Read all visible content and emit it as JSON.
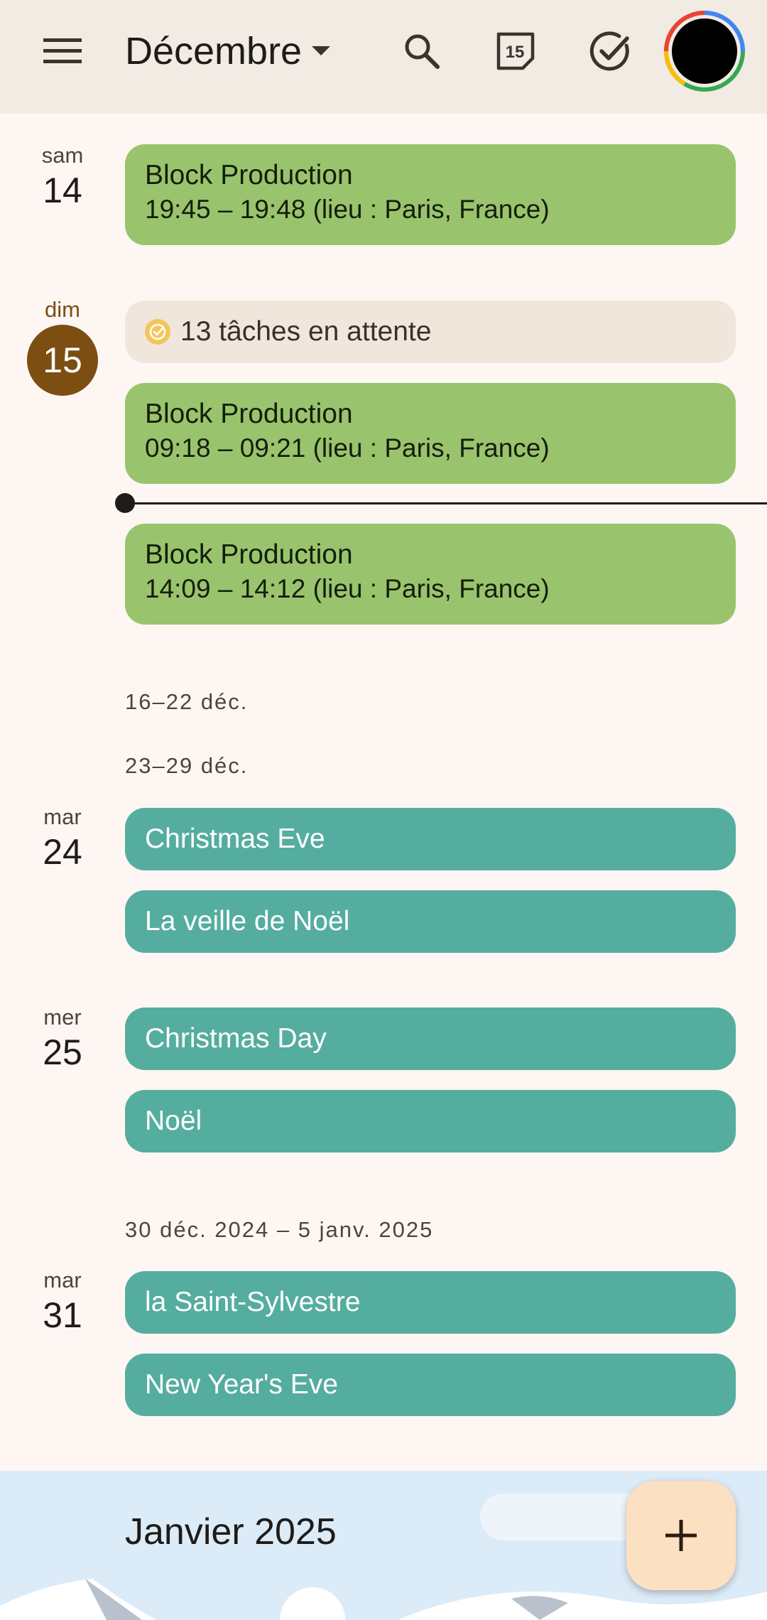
{
  "header": {
    "month": "Décembre",
    "icons": {
      "menu": "menu-icon",
      "dropdown": "arrow-drop-down-icon",
      "search": "search-icon",
      "today": "calendar-today-icon",
      "tasks": "tasks-check-icon",
      "avatar": "avatar"
    },
    "today_day": "15"
  },
  "days": [
    {
      "dow": "sam",
      "num": "14",
      "events": [
        {
          "title": "Block Production",
          "time": "19:45 – 19:48 (lieu : Paris, France)"
        }
      ]
    },
    {
      "dow": "dim",
      "num": "15",
      "is_today": true,
      "tasks_chip": "13 tâches en attente",
      "events": [
        {
          "title": "Block Production",
          "time": "09:18 – 09:21 (lieu : Paris, France)"
        },
        {
          "title": "Block Production",
          "time": "14:09 – 14:12 (lieu : Paris, France)"
        }
      ]
    },
    {
      "dow": "mar",
      "num": "24",
      "events": [
        {
          "title": "Christmas Eve"
        },
        {
          "title": "La veille de Noël"
        }
      ]
    },
    {
      "dow": "mer",
      "num": "25",
      "events": [
        {
          "title": "Christmas Day"
        },
        {
          "title": "Noël"
        }
      ]
    },
    {
      "dow": "mar",
      "num": "31",
      "events": [
        {
          "title": "la Saint-Sylvestre"
        },
        {
          "title": "New Year's Eve"
        }
      ]
    }
  ],
  "week_labels": [
    "16–22 déc.",
    "23–29 déc.",
    "30 déc. 2024 – 5 janv. 2025"
  ],
  "month_banner": {
    "title": "Janvier 2025"
  },
  "fab": {
    "icon": "add-icon"
  },
  "colors": {
    "header_bg": "#f1ebe4",
    "page_bg": "#fdf6f3",
    "event_green": "#99c46d",
    "event_teal": "#55ad9f",
    "today_circle": "#7c4e12",
    "tasks_chip_bg": "#f0e6dc",
    "fab_bg": "#fce0c2",
    "banner_bg": "#dcebf8"
  }
}
